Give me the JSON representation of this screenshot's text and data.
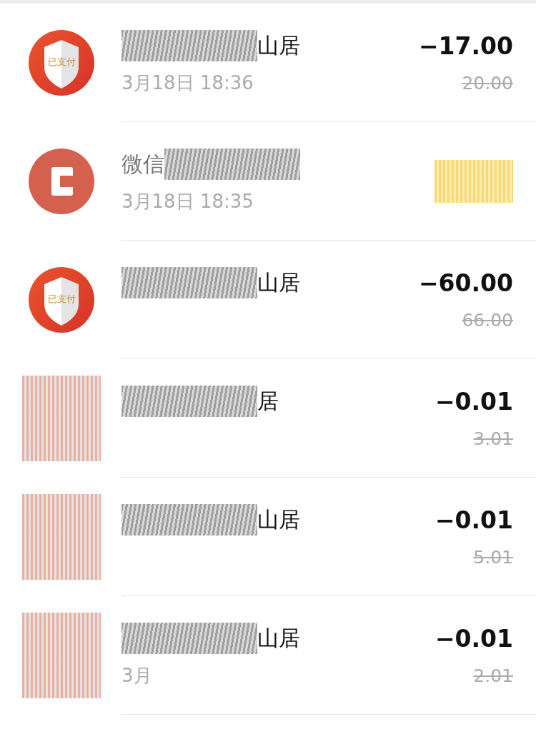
{
  "transactions": [
    {
      "kind": "shield",
      "icon_text": "已支付",
      "title": "山居",
      "date": "3月18日 18:36",
      "amount": "−17.00",
      "original": "20.00"
    },
    {
      "kind": "wallet",
      "title": "微信",
      "date": "3月18日 18:35",
      "amount_redacted": true
    },
    {
      "kind": "shield",
      "icon_text": "已支付",
      "title": "山居",
      "amount": "−60.00",
      "original": "66.00"
    },
    {
      "kind": "redacted",
      "title": "居",
      "amount": "−0.01",
      "original": "3.01"
    },
    {
      "kind": "redacted",
      "title": "山居",
      "amount": "−0.01",
      "original": "5.01"
    },
    {
      "kind": "redacted",
      "title": "山居",
      "date": "3月",
      "amount": "−0.01",
      "original": "2.01"
    }
  ]
}
